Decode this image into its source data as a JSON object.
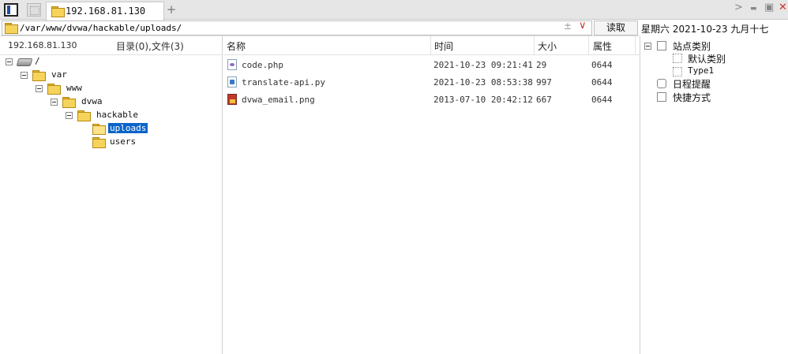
{
  "tab": {
    "title": "192.168.81.130",
    "add_label": "+"
  },
  "window": {
    "next_label": ">",
    "minimize_label": "▬",
    "maximize_label": "▣",
    "close_label": "✕"
  },
  "pathbar": {
    "path": "/var/www/dvwa/hackable/uploads/",
    "sort_symbol": "±",
    "dropdown_symbol": "∨",
    "read_button": "读取"
  },
  "date_line": "星期六 2021-10-23 九月十七",
  "left": {
    "host": "192.168.81.130",
    "counts": "目录(0),文件(3)",
    "tree": [
      {
        "label": "/",
        "icon": "drive-icon",
        "selected": false
      },
      {
        "label": "var",
        "icon": "folder-icon",
        "selected": false
      },
      {
        "label": "www",
        "icon": "folder-icon",
        "selected": false
      },
      {
        "label": "dvwa",
        "icon": "folder-icon",
        "selected": false
      },
      {
        "label": "hackable",
        "icon": "folder-icon",
        "selected": false
      },
      {
        "label": "uploads",
        "icon": "folder-open-icon",
        "selected": true
      },
      {
        "label": "users",
        "icon": "folder-icon",
        "selected": false
      }
    ]
  },
  "files": {
    "columns": {
      "name": "名称",
      "time": "时间",
      "size": "大小",
      "attr": "属性"
    },
    "rows": [
      {
        "name": "code.php",
        "time": "2021-10-23 09:21:41",
        "size": "29",
        "attr": "0644",
        "icon": "php-file-icon"
      },
      {
        "name": "translate-api.py",
        "time": "2021-10-23 08:53:38",
        "size": "997",
        "attr": "0644",
        "icon": "python-file-icon"
      },
      {
        "name": "dvwa_email.png",
        "time": "2013-07-10 20:42:12",
        "size": "667",
        "attr": "0644",
        "icon": "image-file-icon"
      }
    ]
  },
  "right": {
    "site_category": "站点类别",
    "default_category": "默认类别",
    "type1": "Type1",
    "schedule": "日程提醒",
    "shortcuts": "快捷方式"
  }
}
